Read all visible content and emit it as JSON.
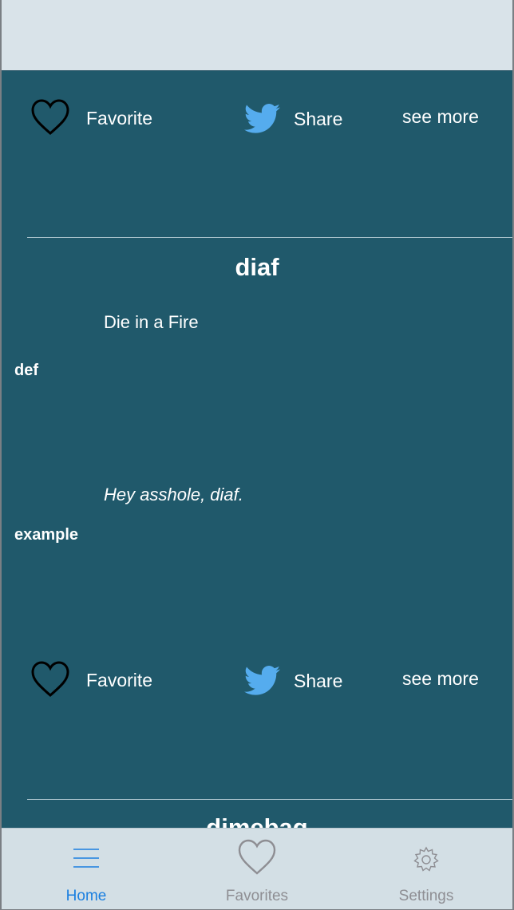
{
  "entries": [
    {
      "actions": {
        "favorite_label": "Favorite",
        "share_label": "Share",
        "see_more_label": "see more"
      }
    },
    {
      "word": "diaf",
      "definition": "Die in a Fire",
      "definition_label": "def",
      "example": "Hey asshole, diaf.",
      "example_label": "example",
      "actions": {
        "favorite_label": "Favorite",
        "share_label": "Share",
        "see_more_label": "see more"
      }
    },
    {
      "word": "dimebag"
    }
  ],
  "tabbar": {
    "tabs": [
      {
        "label": "Home",
        "icon": "menu-lines-icon",
        "active": true
      },
      {
        "label": "Favorites",
        "icon": "heart-icon",
        "active": false
      },
      {
        "label": "Settings",
        "icon": "gear-icon",
        "active": false
      }
    ],
    "active_color": "#1a7fe0",
    "inactive_color": "#8e8e93"
  },
  "colors": {
    "feed_bg": "#20596b",
    "share_icon": "#55acee"
  }
}
